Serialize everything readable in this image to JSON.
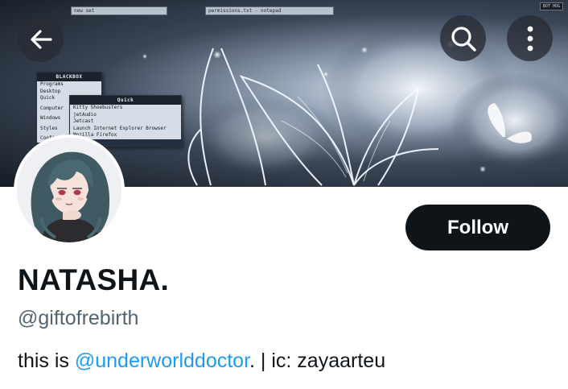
{
  "header": {
    "back_icon": "arrow-left-icon",
    "search_icon": "search-icon",
    "more_icon": "more-vertical-icon"
  },
  "banner": {
    "window_titles": [
      "new set",
      "permissions.txt - notepad"
    ],
    "tray_items": [
      "",
      "BOT HOG",
      "",
      ""
    ],
    "menu_blackbox": {
      "title": "BLACKBOX",
      "items": [
        "Programs",
        "Desktop",
        "Quick",
        "Computer",
        "Windows",
        "Styles",
        "Configuration"
      ]
    },
    "menu_quick": {
      "title": "Quick",
      "items": [
        "Kitty Shoebusters",
        "jetAudio",
        "Jetcast",
        "Launch Internet Explorer Browser",
        "Mozilla Firefox",
        "Desktop"
      ],
      "selected_index": 5
    }
  },
  "profile": {
    "display_name": "NATASHA.",
    "handle": "@giftofrebirth",
    "bio_prefix": "this is ",
    "bio_mention": "@underworlddoctor",
    "bio_suffix": ". | ic: zayaarteu"
  },
  "actions": {
    "follow_label": "Follow"
  },
  "colors": {
    "follow_bg": "#0f1419",
    "follow_text": "#ffffff",
    "name_text": "#0f1419",
    "handle_text": "#536471",
    "mention": "#1d9bf0",
    "overlay_button": "#282c34"
  }
}
